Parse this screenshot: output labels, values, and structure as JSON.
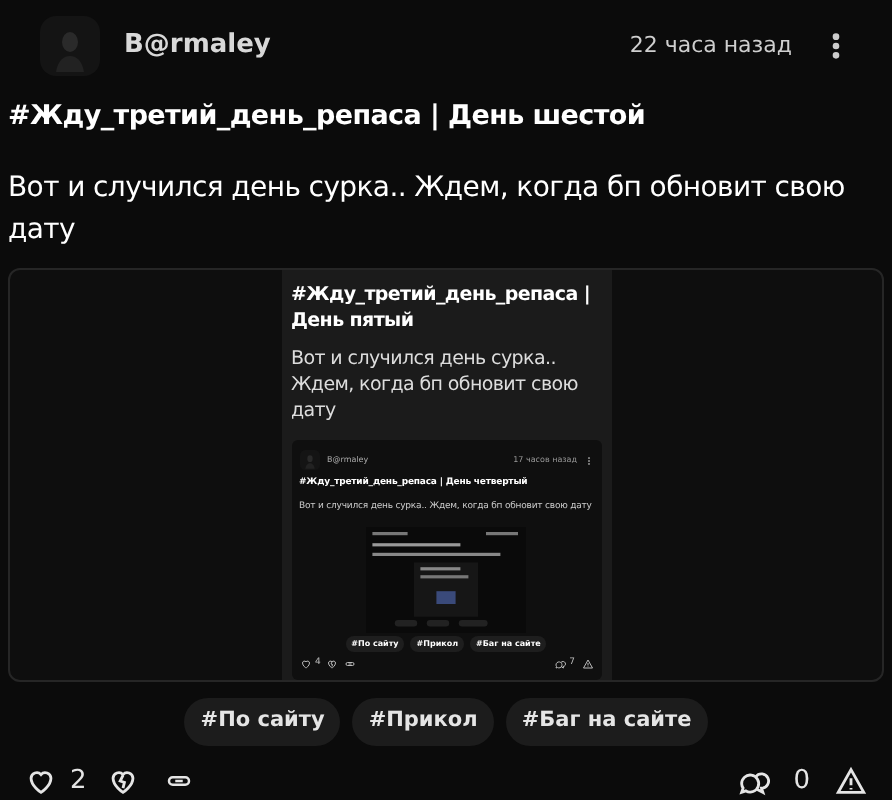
{
  "post": {
    "author": "B@rmaley",
    "time": "22 часа назад",
    "title": "#Жду_третий_день_репаса | День шестой",
    "body": "Вот и случился день сурка.. Ждем, когда бп обновит свою дату",
    "attachment": {
      "kind": "screenshot",
      "title": "#Жду_третий_день_репаса | День пятый",
      "body": "Вот и случился день сурка.. Ждем, когда бп обновит свою дату",
      "post": {
        "author": "B@rmaley",
        "time": "17 часов назад",
        "title": "#Жду_третий_день_репаса | День четвертый",
        "body": "Вот и случился день сурка.. Ждем, когда бп обновит свою дату",
        "tags": [
          "#По сайту",
          "#Прикол",
          "#Баг на сайте"
        ],
        "likes": "4",
        "comments": "7"
      }
    },
    "tags": [
      "#По сайту",
      "#Прикол",
      "#Баг на сайте"
    ],
    "likes": "2",
    "comments": "0"
  }
}
